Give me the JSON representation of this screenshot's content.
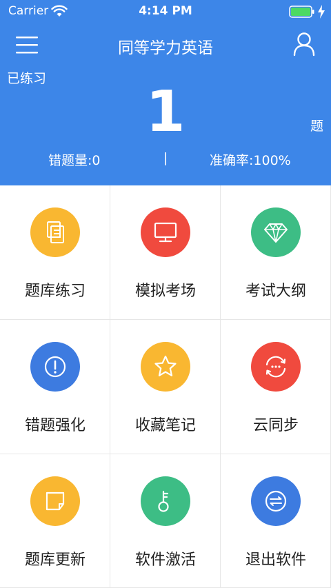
{
  "status_bar": {
    "carrier": "Carrier",
    "time": "4:14 PM"
  },
  "header": {
    "title": "同等学力英语",
    "practiced_label": "已练习",
    "practiced_count": "1",
    "practiced_unit": "题",
    "wrong_count": "错题量:0",
    "divider": "|",
    "accuracy": "准确率:100%"
  },
  "menu": [
    {
      "label": "题库练习",
      "icon": "documents-icon",
      "color": "#f9b731"
    },
    {
      "label": "模拟考场",
      "icon": "monitor-icon",
      "color": "#f04a3e"
    },
    {
      "label": "考试大纲",
      "icon": "diamond-icon",
      "color": "#3dbd85"
    },
    {
      "label": "错题强化",
      "icon": "exclamation-icon",
      "color": "#3d7be0"
    },
    {
      "label": "收藏笔记",
      "icon": "star-icon",
      "color": "#f9b731"
    },
    {
      "label": "云同步",
      "icon": "sync-icon",
      "color": "#f04a3e"
    },
    {
      "label": "题库更新",
      "icon": "refresh-box-icon",
      "color": "#f9b731"
    },
    {
      "label": "软件激活",
      "icon": "key-icon",
      "color": "#3dbd85"
    },
    {
      "label": "退出软件",
      "icon": "exchange-icon",
      "color": "#3d7be0"
    }
  ]
}
